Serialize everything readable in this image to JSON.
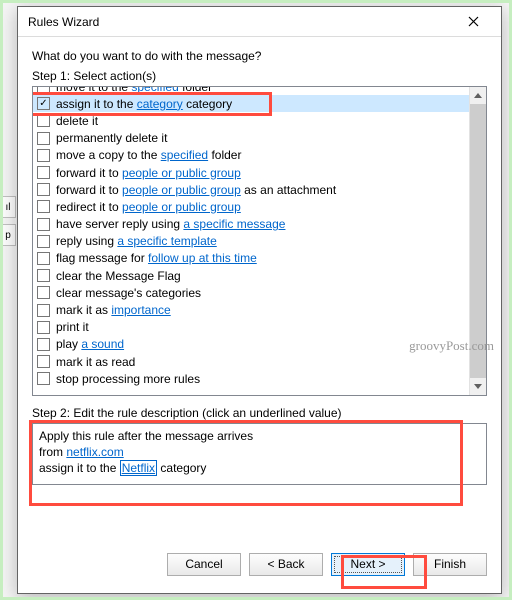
{
  "window": {
    "title": "Rules Wizard"
  },
  "prompt": "What do you want to do with the message?",
  "step1_label": "Step 1: Select action(s)",
  "actions": [
    {
      "checked": false,
      "parts": [
        {
          "t": "move it to the "
        },
        {
          "t": "specified",
          "link": true
        },
        {
          "t": " folder"
        }
      ],
      "cut": true
    },
    {
      "checked": true,
      "selected": true,
      "parts": [
        {
          "t": "assign it to the "
        },
        {
          "t": "category",
          "link": true
        },
        {
          "t": " category"
        }
      ]
    },
    {
      "checked": false,
      "parts": [
        {
          "t": "delete it"
        }
      ]
    },
    {
      "checked": false,
      "parts": [
        {
          "t": "permanently delete it"
        }
      ]
    },
    {
      "checked": false,
      "parts": [
        {
          "t": "move a copy to the "
        },
        {
          "t": "specified",
          "link": true
        },
        {
          "t": " folder"
        }
      ]
    },
    {
      "checked": false,
      "parts": [
        {
          "t": "forward it to "
        },
        {
          "t": "people or public group",
          "link": true
        }
      ]
    },
    {
      "checked": false,
      "parts": [
        {
          "t": "forward it to "
        },
        {
          "t": "people or public group",
          "link": true
        },
        {
          "t": " as an attachment"
        }
      ]
    },
    {
      "checked": false,
      "parts": [
        {
          "t": "redirect it to "
        },
        {
          "t": "people or public group",
          "link": true
        }
      ]
    },
    {
      "checked": false,
      "parts": [
        {
          "t": "have server reply using "
        },
        {
          "t": "a specific message",
          "link": true
        }
      ]
    },
    {
      "checked": false,
      "parts": [
        {
          "t": "reply using "
        },
        {
          "t": "a specific template",
          "link": true
        }
      ]
    },
    {
      "checked": false,
      "parts": [
        {
          "t": "flag message for "
        },
        {
          "t": "follow up at this time",
          "link": true
        }
      ]
    },
    {
      "checked": false,
      "parts": [
        {
          "t": "clear the Message Flag"
        }
      ]
    },
    {
      "checked": false,
      "parts": [
        {
          "t": "clear message's categories"
        }
      ]
    },
    {
      "checked": false,
      "parts": [
        {
          "t": "mark it as "
        },
        {
          "t": "importance",
          "link": true
        }
      ]
    },
    {
      "checked": false,
      "parts": [
        {
          "t": "print it"
        }
      ]
    },
    {
      "checked": false,
      "parts": [
        {
          "t": "play "
        },
        {
          "t": "a sound",
          "link": true
        }
      ]
    },
    {
      "checked": false,
      "parts": [
        {
          "t": "mark it as read"
        }
      ]
    },
    {
      "checked": false,
      "parts": [
        {
          "t": "stop processing more rules"
        }
      ]
    }
  ],
  "step2_label": "Step 2: Edit the rule description (click an underlined value)",
  "description": {
    "line1": "Apply this rule after the message arrives",
    "line2_prefix": "from ",
    "line2_link": "netflix.com",
    "line3_prefix": "assign it to the ",
    "line3_value": "Netflix",
    "line3_suffix": " category"
  },
  "buttons": {
    "cancel": "Cancel",
    "back": "< Back",
    "next": "Next >",
    "finish": "Finish"
  },
  "watermark": "groovyPost.com"
}
